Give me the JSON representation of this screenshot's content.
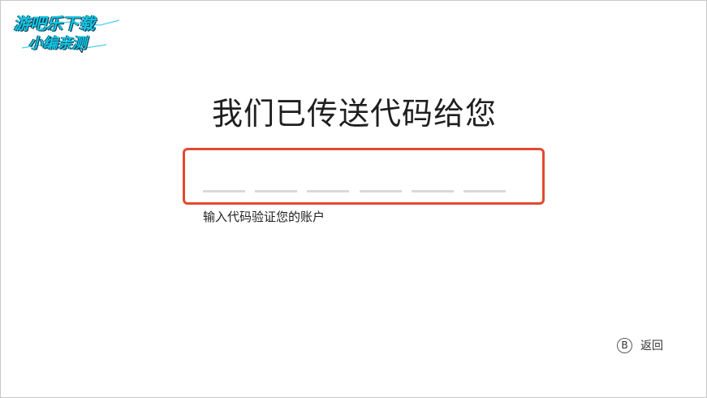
{
  "watermark": {
    "line1": "游吧乐下载",
    "line2": "小编亲测"
  },
  "page": {
    "title": "我们已传送代码给您",
    "hint": "输入代码验证您的账户"
  },
  "code_input": {
    "slots": [
      "",
      "",
      "",
      "",
      "",
      ""
    ],
    "border_color": "#e24a30"
  },
  "footer": {
    "back_key": "B",
    "back_label": "返回",
    "back_icon": "b-button-icon"
  }
}
